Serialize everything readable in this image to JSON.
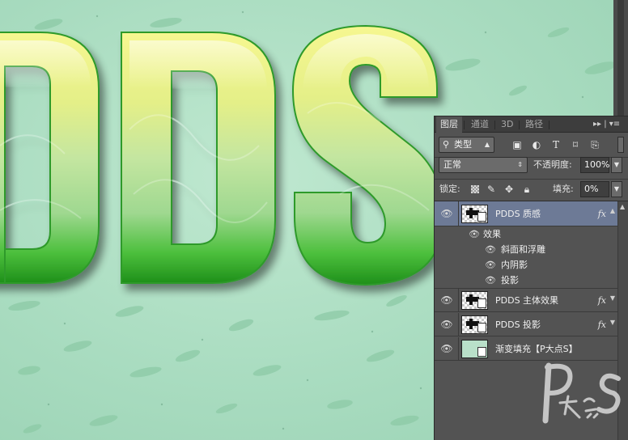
{
  "canvas": {
    "text": "PDDS",
    "background_color": "#a9dcc0"
  },
  "panel": {
    "tabs": [
      "图层",
      "通道",
      "3D",
      "路径"
    ],
    "active_tab": "图层",
    "menu_glyphs": "▸▸ | ▾≡",
    "filter": {
      "icon": "search-icon",
      "value": "类型",
      "icons": [
        "image-filter-icon",
        "adjustment-filter-icon",
        "type-filter-icon",
        "shape-filter-icon",
        "smart-object-filter-icon"
      ]
    },
    "blend_mode": "正常",
    "opacity_label": "不透明度:",
    "opacity_value": "100%",
    "lock_label": "锁定:",
    "lock_icons": [
      "lock-transparent-icon",
      "lock-paint-icon",
      "lock-position-icon",
      "lock-all-icon"
    ],
    "fill_label": "填充:",
    "fill_value": "0%",
    "layers": [
      {
        "name": "PDDS 质感",
        "fx": "fx",
        "selected": true,
        "effects_label": "效果",
        "effects": [
          "斜面和浮雕",
          "内阴影",
          "投影"
        ]
      },
      {
        "name": "PDDS 主体效果",
        "fx": "fx",
        "selected": false
      },
      {
        "name": "PDDS 投影",
        "fx": "fx",
        "selected": false
      },
      {
        "name": "渐变填充【P大点S】",
        "fx": "",
        "selected": false
      }
    ]
  },
  "watermark": {
    "text": "P大点S"
  }
}
